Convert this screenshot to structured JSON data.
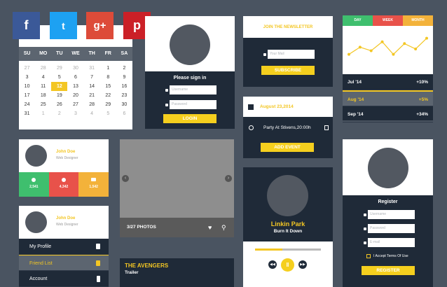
{
  "social": [
    {
      "name": "facebook",
      "glyph": "f",
      "color": "#3b5998"
    },
    {
      "name": "twitter",
      "glyph": "t",
      "color": "#1da1f2"
    },
    {
      "name": "googleplus",
      "glyph": "g+",
      "color": "#dd4b39"
    },
    {
      "name": "pinterest",
      "glyph": "p",
      "color": "#cb2027"
    }
  ],
  "calendar": {
    "days": [
      "SU",
      "MO",
      "TU",
      "WE",
      "TH",
      "FR",
      "SA"
    ],
    "weeks": [
      [
        "27",
        "28",
        "29",
        "30",
        "31",
        "1",
        "2"
      ],
      [
        "3",
        "4",
        "5",
        "6",
        "7",
        "8",
        "9"
      ],
      [
        "10",
        "11",
        "12",
        "13",
        "14",
        "15",
        "16"
      ],
      [
        "17",
        "18",
        "19",
        "20",
        "21",
        "22",
        "23"
      ],
      [
        "24",
        "25",
        "26",
        "27",
        "28",
        "29",
        "30"
      ],
      [
        "31",
        "1",
        "2",
        "3",
        "4",
        "5",
        "6"
      ]
    ]
  },
  "login": {
    "title": "Please sign in",
    "username_placeholder": "Username",
    "password_placeholder": "Password",
    "button": "LOGIN"
  },
  "newsletter": {
    "title": "JOIN THE NEWSLETTER",
    "email_placeholder": "Your Mail",
    "button": "SUBSCRIBE"
  },
  "event": {
    "date": "August 23,2014",
    "text": "Party At Stivens,20:00h",
    "button": "ADD EVENT"
  },
  "chart": {
    "tabs": [
      "DAY",
      "WEEK",
      "MONTH"
    ],
    "rows": [
      {
        "label": "Jul '14",
        "value": "+10%"
      },
      {
        "label": "Aug '14",
        "value": "+5%"
      },
      {
        "label": "Sep '14",
        "value": "+34%"
      }
    ]
  },
  "chart_data": {
    "type": "line",
    "values": [
      4,
      6,
      5,
      7.5,
      4,
      7,
      5.5,
      8.5
    ],
    "ylim": [
      0,
      10
    ]
  },
  "profile1": {
    "name": "John Doe",
    "role": "Web Designer",
    "stats": [
      "2,541",
      "4,342",
      "1,542"
    ]
  },
  "gallery": {
    "caption": "3/27 PHOTOS"
  },
  "music": {
    "artist": "Linkin Park",
    "song": "Burn It Down"
  },
  "profile2": {
    "name": "John Doe",
    "role": "Web Designer",
    "menu": [
      "My Profile",
      "Friend List",
      "Account"
    ]
  },
  "movie": {
    "title": "THE AVENGERS",
    "subtitle": "Trailer"
  },
  "register": {
    "title": "Register",
    "username_placeholder": "Username",
    "password_placeholder": "Password",
    "email_placeholder": "E-mail",
    "terms": "I Accept Terms Of Use",
    "button": "REGISTER"
  }
}
